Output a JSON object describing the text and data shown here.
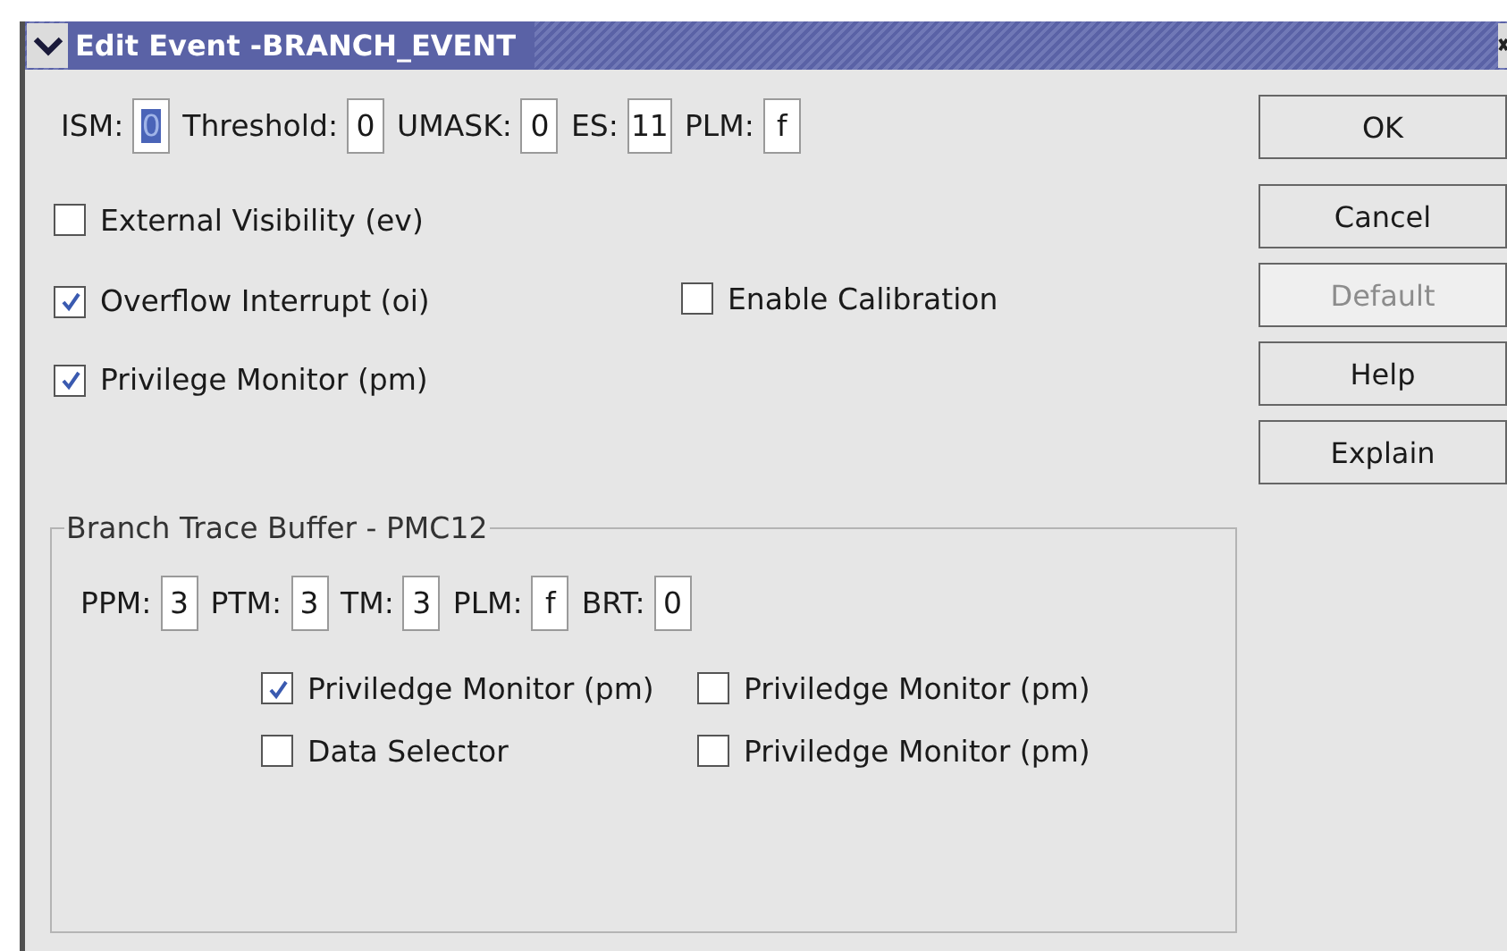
{
  "window": {
    "title": "Edit Event -BRANCH_EVENT"
  },
  "fields": [
    {
      "label": "ISM:",
      "value": "0",
      "text_selected": true
    },
    {
      "label": "Threshold:",
      "value": "0",
      "text_selected": false
    },
    {
      "label": "UMASK:",
      "value": "0",
      "text_selected": false
    },
    {
      "label": "ES:",
      "value": "11",
      "text_selected": false
    },
    {
      "label": "PLM:",
      "value": "f",
      "text_selected": false
    }
  ],
  "option_rows": [
    [
      {
        "label": "External Visibility (ev)",
        "checked": false
      }
    ],
    [
      {
        "label": "Overflow Interrupt (oi)",
        "checked": true
      },
      {
        "label": "Enable Calibration",
        "checked": false
      }
    ],
    [
      {
        "label": "Privilege Monitor (pm)",
        "checked": true
      }
    ]
  ],
  "group": {
    "title": "Branch Trace Buffer - PMC12",
    "fields": [
      {
        "label": "PPM:",
        "value": "3",
        "text_selected": false
      },
      {
        "label": "PTM:",
        "value": "3",
        "text_selected": false
      },
      {
        "label": "TM:",
        "value": "3",
        "text_selected": false
      },
      {
        "label": "PLM:",
        "value": "f",
        "text_selected": false
      },
      {
        "label": "BRT:",
        "value": "0",
        "text_selected": false
      }
    ],
    "option_rows": [
      [
        {
          "label": "Priviledge Monitor (pm)",
          "checked": true
        },
        {
          "label": "Priviledge Monitor (pm)",
          "checked": false
        }
      ],
      [
        {
          "label": "Data Selector",
          "checked": false
        },
        {
          "label": "Priviledge Monitor (pm)",
          "checked": false
        }
      ]
    ]
  },
  "buttons": [
    {
      "label": "OK",
      "disabled": false
    },
    {
      "label": "Cancel",
      "disabled": false
    },
    {
      "label": "Default",
      "disabled": true
    },
    {
      "label": "Help",
      "disabled": false
    },
    {
      "label": "Explain",
      "disabled": false
    }
  ]
}
